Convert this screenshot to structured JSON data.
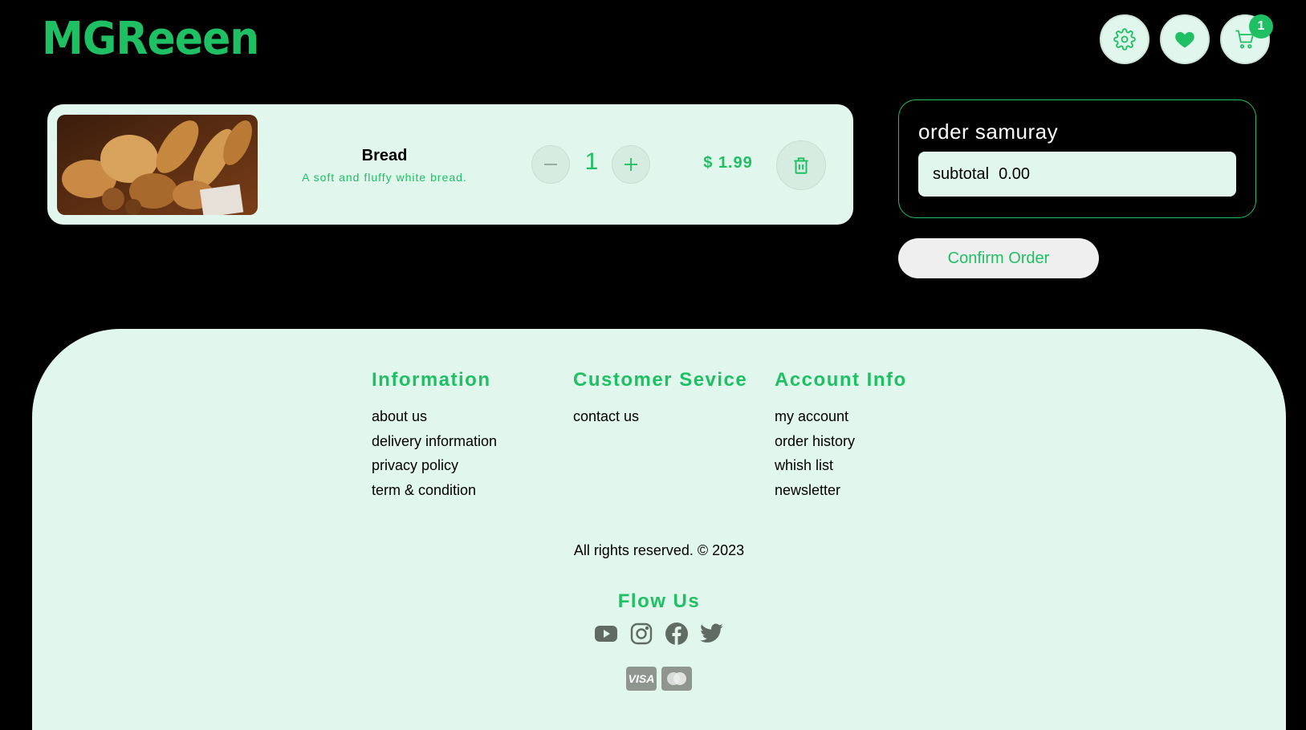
{
  "header": {
    "logo": "MGReeen",
    "cart_count": "1"
  },
  "cart": {
    "items": [
      {
        "name": "Bread",
        "description": "A soft and fluffy white bread.",
        "quantity": "1",
        "price": "$ 1.99"
      }
    ]
  },
  "summary": {
    "title": "order samuray",
    "subtotal_label": "subtotal",
    "subtotal_value": "0.00",
    "confirm_label": "Confirm Order"
  },
  "footer": {
    "columns": [
      {
        "title": "Information",
        "links": [
          "about us",
          "delivery information",
          "privacy policy",
          "term & condition"
        ]
      },
      {
        "title": "Customer Sevice",
        "links": [
          "contact us"
        ]
      },
      {
        "title": "Account Info",
        "links": [
          "my account",
          "order history",
          "whish list",
          "newsletter"
        ]
      }
    ],
    "rights": "All rights reserved. © 2023",
    "follow_title": "Flow Us",
    "social_icons": [
      "youtube-icon",
      "instagram-icon",
      "facebook-icon",
      "twitter-icon"
    ],
    "payments": [
      "VISA",
      "mastercard"
    ]
  },
  "colors": {
    "background": "#000000",
    "accent": "#1fc063",
    "panel": "#e1f6ec"
  }
}
